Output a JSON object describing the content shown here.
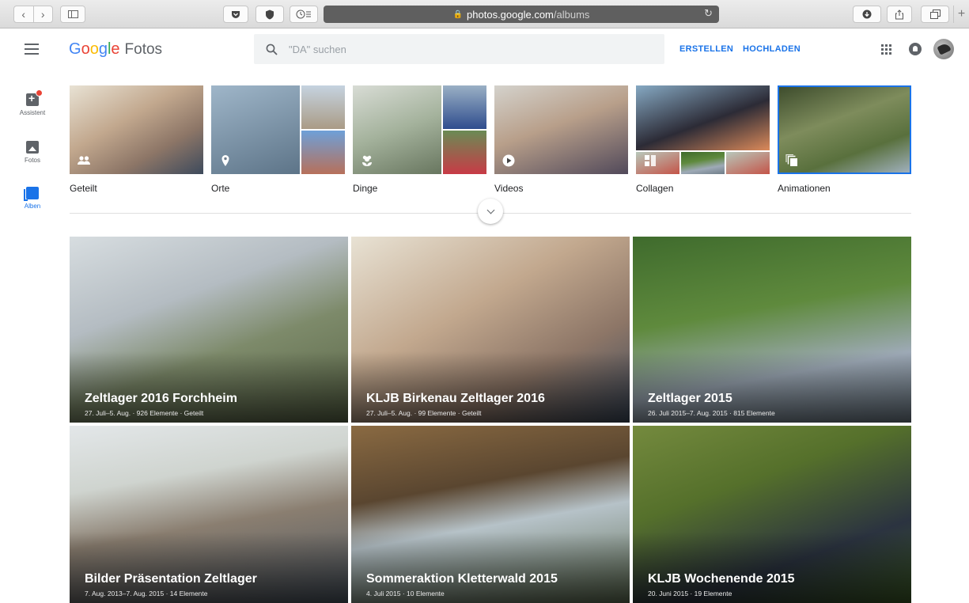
{
  "browser": {
    "url_host": "photos.google.com",
    "url_path": "/albums"
  },
  "app": {
    "logo_google": [
      "G",
      "o",
      "o",
      "g",
      "l",
      "e"
    ],
    "logo_product": "Fotos",
    "search_placeholder": "\"DA\" suchen",
    "create_label": "ERSTELLEN",
    "upload_label": "HOCHLADEN"
  },
  "rail": {
    "items": [
      {
        "label": "Assistent",
        "icon": "assistant-icon",
        "active": false
      },
      {
        "label": "Fotos",
        "icon": "photo-icon",
        "active": false
      },
      {
        "label": "Alben",
        "icon": "albums-icon",
        "active": true
      }
    ]
  },
  "categories": [
    {
      "label": "Geteilt",
      "icon": "people-icon"
    },
    {
      "label": "Orte",
      "icon": "location-pin-icon"
    },
    {
      "label": "Dinge",
      "icon": "flower-icon"
    },
    {
      "label": "Videos",
      "icon": "play-icon"
    },
    {
      "label": "Collagen",
      "icon": "collage-icon"
    },
    {
      "label": "Animationen",
      "icon": "animation-icon",
      "selected": true
    }
  ],
  "albums": [
    {
      "title": "Zeltlager 2016 Forchheim",
      "meta": "27. Juli–5. Aug.  ·  926 Elemente  ·  Geteilt"
    },
    {
      "title": "KLJB Birkenau Zeltlager 2016",
      "meta": "27. Juli–5. Aug.  ·  99 Elemente  ·  Geteilt"
    },
    {
      "title": "Zeltlager 2015",
      "meta": "26. Juli 2015–7. Aug. 2015  ·  815 Elemente"
    },
    {
      "title": "Bilder Präsentation Zeltlager",
      "meta": "7. Aug. 2013–7. Aug. 2015  ·  14 Elemente"
    },
    {
      "title": "Sommeraktion Kletterwald 2015",
      "meta": "4. Juli 2015  ·  10 Elemente"
    },
    {
      "title": "KLJB Wochenende 2015",
      "meta": "20. Juni 2015  ·  19 Elemente"
    }
  ]
}
